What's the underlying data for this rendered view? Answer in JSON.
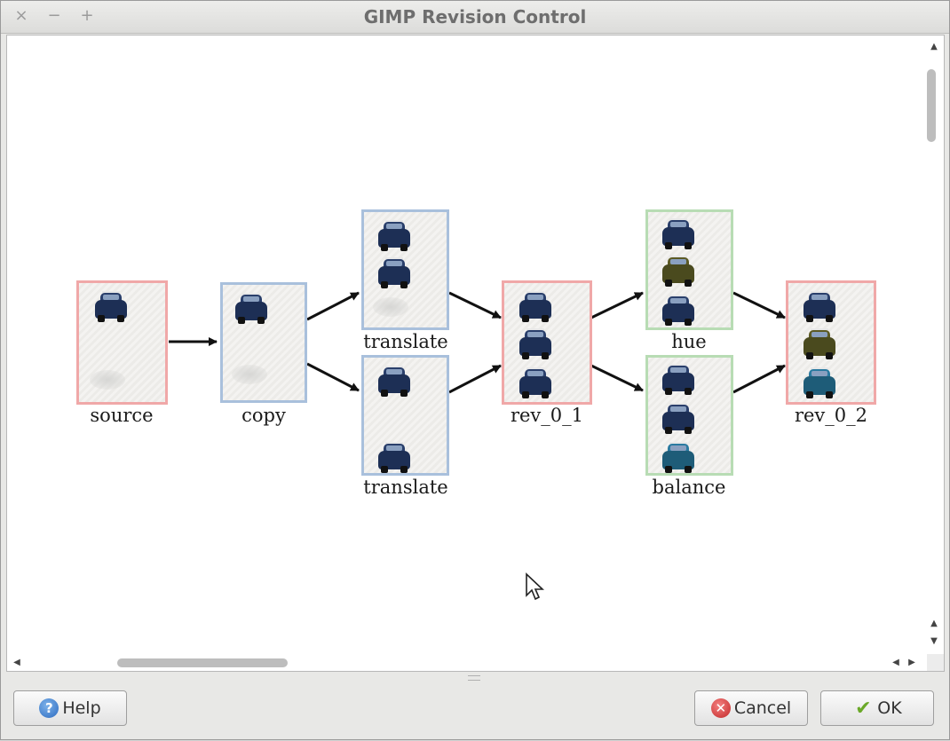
{
  "window": {
    "title": "GIMP Revision Control",
    "controls": {
      "close": "×",
      "minimize": "−",
      "maximize": "+"
    }
  },
  "graph": {
    "nodes": [
      {
        "id": "source",
        "label": "source",
        "border": "red",
        "cars": [
          "navy"
        ]
      },
      {
        "id": "copy",
        "label": "copy",
        "border": "blue",
        "cars": [
          "navy"
        ]
      },
      {
        "id": "translate1",
        "label": "translate",
        "border": "blue",
        "cars": [
          "navy",
          "navy"
        ]
      },
      {
        "id": "translate2",
        "label": "translate",
        "border": "blue",
        "cars": [
          "navy",
          "navy"
        ]
      },
      {
        "id": "rev_0_1",
        "label": "rev_0_1",
        "border": "red",
        "cars": [
          "navy",
          "navy",
          "navy"
        ]
      },
      {
        "id": "hue",
        "label": "hue",
        "border": "green",
        "cars": [
          "navy",
          "olive",
          "navy"
        ]
      },
      {
        "id": "balance",
        "label": "balance",
        "border": "green",
        "cars": [
          "navy",
          "navy",
          "teal"
        ]
      },
      {
        "id": "rev_0_2",
        "label": "rev_0_2",
        "border": "red",
        "cars": [
          "navy",
          "olive",
          "teal"
        ]
      }
    ],
    "edges": [
      [
        "source",
        "copy"
      ],
      [
        "copy",
        "translate1"
      ],
      [
        "copy",
        "translate2"
      ],
      [
        "translate1",
        "rev_0_1"
      ],
      [
        "translate2",
        "rev_0_1"
      ],
      [
        "rev_0_1",
        "hue"
      ],
      [
        "rev_0_1",
        "balance"
      ],
      [
        "hue",
        "rev_0_2"
      ],
      [
        "balance",
        "rev_0_2"
      ]
    ]
  },
  "buttons": {
    "help": "Help",
    "cancel": "Cancel",
    "ok": "OK"
  },
  "icons": {
    "help": "help-icon",
    "cancel": "cancel-icon",
    "ok": "checkmark-icon"
  },
  "colors": {
    "red_border": "#f0a8a8",
    "blue_border": "#a9c0dc",
    "green_border": "#b8dcb4"
  }
}
